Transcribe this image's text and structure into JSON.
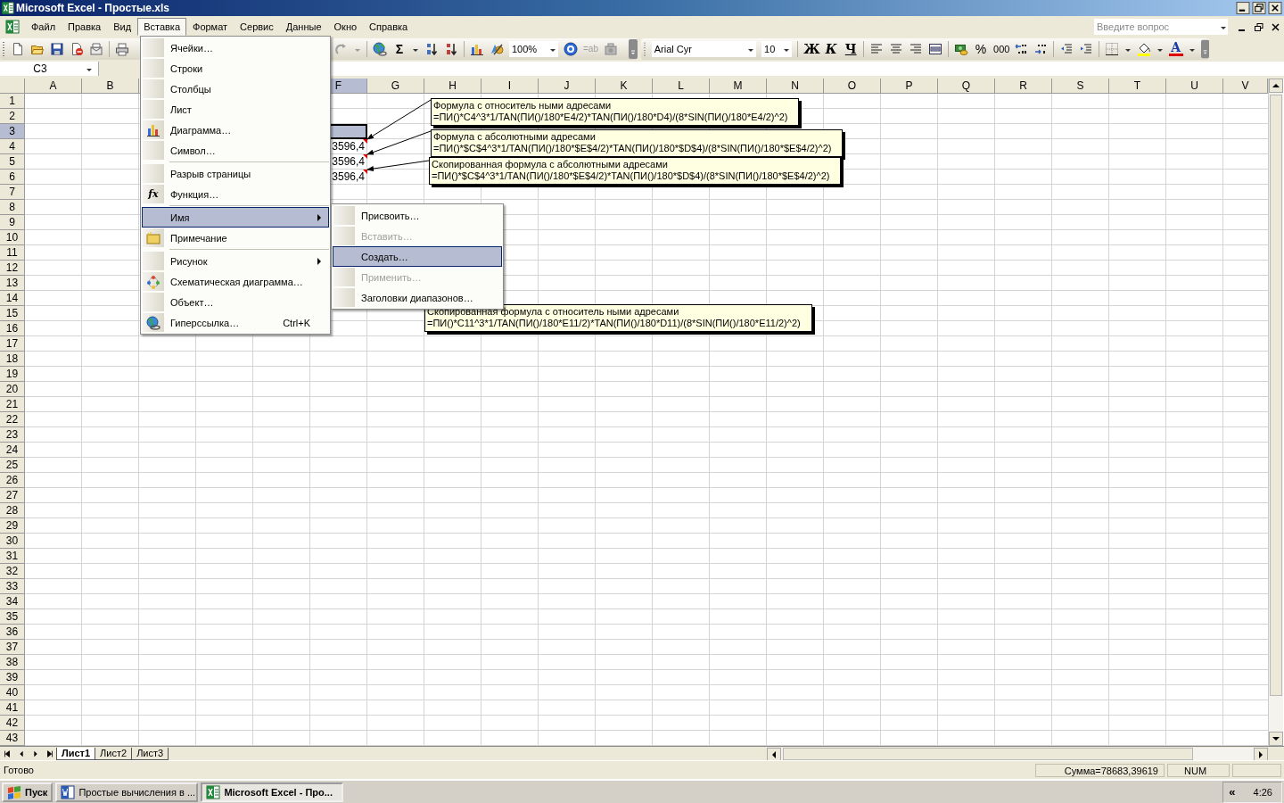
{
  "window": {
    "title": "Microsoft Excel - Простые.xls"
  },
  "menu_bar": {
    "items": [
      {
        "label": "Файл",
        "open": false
      },
      {
        "label": "Правка",
        "open": false
      },
      {
        "label": "Вид",
        "open": false
      },
      {
        "label": "Вставка",
        "open": true
      },
      {
        "label": "Формат",
        "open": false
      },
      {
        "label": "Сервис",
        "open": false
      },
      {
        "label": "Данные",
        "open": false
      },
      {
        "label": "Окно",
        "open": false
      },
      {
        "label": "Справка",
        "open": false
      }
    ]
  },
  "help_search": {
    "placeholder": "Введите вопрос"
  },
  "standard_toolbar": {
    "autosum": "Σ",
    "zoom": "100%",
    "text_tool": "=ab"
  },
  "formatting_toolbar": {
    "font": "Arial Cyr",
    "size": "10",
    "bold": "Ж",
    "italic": "К",
    "underline": "Ч",
    "percent": "%",
    "thousands": "000",
    "font_color": "A"
  },
  "name_box": "C3",
  "sheet": {
    "columns": [
      {
        "label": "A",
        "selected": false
      },
      {
        "label": "B",
        "selected": false
      },
      {
        "label": "F",
        "selected": true
      },
      {
        "label": "G",
        "selected": false
      },
      {
        "label": "H",
        "selected": false
      },
      {
        "label": "I",
        "selected": false
      },
      {
        "label": "J",
        "selected": false
      },
      {
        "label": "K",
        "selected": false
      },
      {
        "label": "L",
        "selected": false
      },
      {
        "label": "M",
        "selected": false
      },
      {
        "label": "N",
        "selected": false
      },
      {
        "label": "O",
        "selected": false
      },
      {
        "label": "P",
        "selected": false
      },
      {
        "label": "Q",
        "selected": false
      },
      {
        "label": "R",
        "selected": false
      },
      {
        "label": "S",
        "selected": false
      },
      {
        "label": "T",
        "selected": false
      },
      {
        "label": "U",
        "selected": false
      },
      {
        "label": "V",
        "selected": false
      }
    ],
    "rows": [
      {
        "label": "1",
        "selected": false
      },
      {
        "label": "2",
        "selected": false
      },
      {
        "label": "3",
        "selected": true,
        "cells": [
          null,
          null,
          {
            "selected": true,
            "comment": false
          }
        ]
      },
      {
        "label": "4",
        "selected": false,
        "cells": [
          null,
          null,
          {
            "value": "3596,4",
            "selected": false,
            "comment": true
          }
        ]
      },
      {
        "label": "5",
        "selected": false,
        "cells": [
          null,
          null,
          {
            "value": "3596,4",
            "selected": false,
            "comment": true
          }
        ]
      },
      {
        "label": "6",
        "selected": false,
        "cells": [
          null,
          null,
          {
            "value": "3596,4",
            "selected": false,
            "comment": true
          }
        ]
      },
      {
        "label": "7",
        "selected": false
      },
      {
        "label": "8",
        "selected": false
      },
      {
        "label": "9",
        "selected": false
      },
      {
        "label": "10",
        "selected": false
      },
      {
        "label": "11",
        "selected": false
      },
      {
        "label": "12",
        "selected": false
      },
      {
        "label": "13",
        "selected": false
      },
      {
        "label": "14",
        "selected": false
      },
      {
        "label": "15",
        "selected": false
      },
      {
        "label": "16",
        "selected": false
      },
      {
        "label": "17",
        "selected": false
      },
      {
        "label": "18",
        "selected": false
      },
      {
        "label": "19",
        "selected": false
      },
      {
        "label": "20",
        "selected": false
      },
      {
        "label": "21",
        "selected": false
      },
      {
        "label": "22",
        "selected": false
      },
      {
        "label": "23",
        "selected": false
      },
      {
        "label": "24",
        "selected": false
      },
      {
        "label": "25",
        "selected": false
      },
      {
        "label": "26",
        "selected": false
      },
      {
        "label": "27",
        "selected": false
      },
      {
        "label": "28",
        "selected": false
      },
      {
        "label": "29",
        "selected": false
      },
      {
        "label": "30",
        "selected": false
      },
      {
        "label": "31",
        "selected": false
      },
      {
        "label": "32",
        "selected": false
      },
      {
        "label": "33",
        "selected": false
      },
      {
        "label": "34",
        "selected": false
      },
      {
        "label": "35",
        "selected": false
      },
      {
        "label": "36",
        "selected": false
      },
      {
        "label": "37",
        "selected": false
      },
      {
        "label": "38",
        "selected": false
      },
      {
        "label": "39",
        "selected": false
      },
      {
        "label": "40",
        "selected": false
      },
      {
        "label": "41",
        "selected": false
      },
      {
        "label": "42",
        "selected": false
      },
      {
        "label": "43",
        "selected": false
      }
    ]
  },
  "comments": [
    {
      "title": "Формула с относитель ными адресами",
      "formula": "=ПИ()*C4^3*1/TAN(ПИ()/180*E4/2)*TAN(ПИ()/180*D4)/(8*SIN(ПИ()/180*E4/2)^2)"
    },
    {
      "title": "Формула с абсолютными адресами",
      "formula": "=ПИ()*$C$4^3*1/TAN(ПИ()/180*$E$4/2)*TAN(ПИ()/180*$D$4)/(8*SIN(ПИ()/180*$E$4/2)^2)"
    },
    {
      "title": "Скопированная формула с абсолютными адресами",
      "formula": "=ПИ()*$C$4^3*1/TAN(ПИ()/180*$E$4/2)*TAN(ПИ()/180*$D$4)/(8*SIN(ПИ()/180*$E$4/2)^2)"
    },
    {
      "title": "Скопированная формула с относитель ными адресами",
      "formula": "=ПИ()*C11^3*1/TAN(ПИ()/180*E11/2)*TAN(ПИ()/180*D11)/(8*SIN(ПИ()/180*E11/2)^2)"
    }
  ],
  "insert_menu": {
    "items": [
      {
        "label": "Ячейки…",
        "kind": "plain",
        "separator_before": false,
        "submenu": false,
        "selected": false
      },
      {
        "label": "Строки",
        "kind": "plain",
        "separator_before": false,
        "submenu": false,
        "selected": false
      },
      {
        "label": "Столбцы",
        "kind": "plain",
        "separator_before": false,
        "submenu": false,
        "selected": false
      },
      {
        "label": "Лист",
        "kind": "plain",
        "separator_before": false,
        "submenu": false,
        "selected": false
      },
      {
        "label": "Диаграмма…",
        "kind": "chart",
        "separator_before": false,
        "submenu": false,
        "selected": false
      },
      {
        "label": "Символ…",
        "kind": "plain",
        "separator_before": false,
        "submenu": false,
        "selected": false
      },
      {
        "label": "Разрыв страницы",
        "kind": "plain",
        "separator_before": true,
        "submenu": false,
        "selected": false
      },
      {
        "label": "Функция…",
        "kind": "function",
        "glyph": "fx",
        "separator_before": false,
        "submenu": false,
        "selected": false
      },
      {
        "label": "Имя",
        "kind": "plain",
        "separator_before": true,
        "submenu": true,
        "selected": true
      },
      {
        "label": "Примечание",
        "kind": "note",
        "separator_before": false,
        "submenu": false,
        "selected": false
      },
      {
        "label": "Рисунок",
        "kind": "plain",
        "separator_before": true,
        "submenu": true,
        "selected": false
      },
      {
        "label": "Схематическая диаграмма…",
        "kind": "diagram",
        "separator_before": false,
        "submenu": false,
        "selected": false
      },
      {
        "label": "Объект…",
        "kind": "plain",
        "separator_before": false,
        "submenu": false,
        "selected": false
      },
      {
        "label": "Гиперссылка…",
        "kind": "link",
        "shortcut": "Ctrl+K",
        "separator_before": false,
        "submenu": false,
        "selected": false
      }
    ]
  },
  "name_submenu": {
    "items": [
      {
        "label": "Присвоить…",
        "disabled": false,
        "selected": false
      },
      {
        "label": "Вставить…",
        "disabled": true,
        "selected": false
      },
      {
        "label": "Создать…",
        "disabled": false,
        "selected": true
      },
      {
        "label": "Применить…",
        "disabled": true,
        "selected": false
      },
      {
        "label": "Заголовки диапазонов…",
        "disabled": false,
        "selected": false
      }
    ]
  },
  "sheet_tabs": [
    {
      "label": "Лист1",
      "selected": true
    },
    {
      "label": "Лист2",
      "selected": false
    },
    {
      "label": "Лист3",
      "selected": false
    }
  ],
  "status_bar": {
    "status": "Готово",
    "sum": "Сумма=78683,39619",
    "num": "NUM"
  },
  "taskbar": {
    "start": "Пуск",
    "tasks": [
      {
        "label": "Простые вычисления в ...",
        "selected": false,
        "kind": "word"
      },
      {
        "label": "Microsoft Excel - Про...",
        "selected": true,
        "kind": "excel"
      }
    ],
    "tray_toggle": "«",
    "clock": "4:26"
  }
}
